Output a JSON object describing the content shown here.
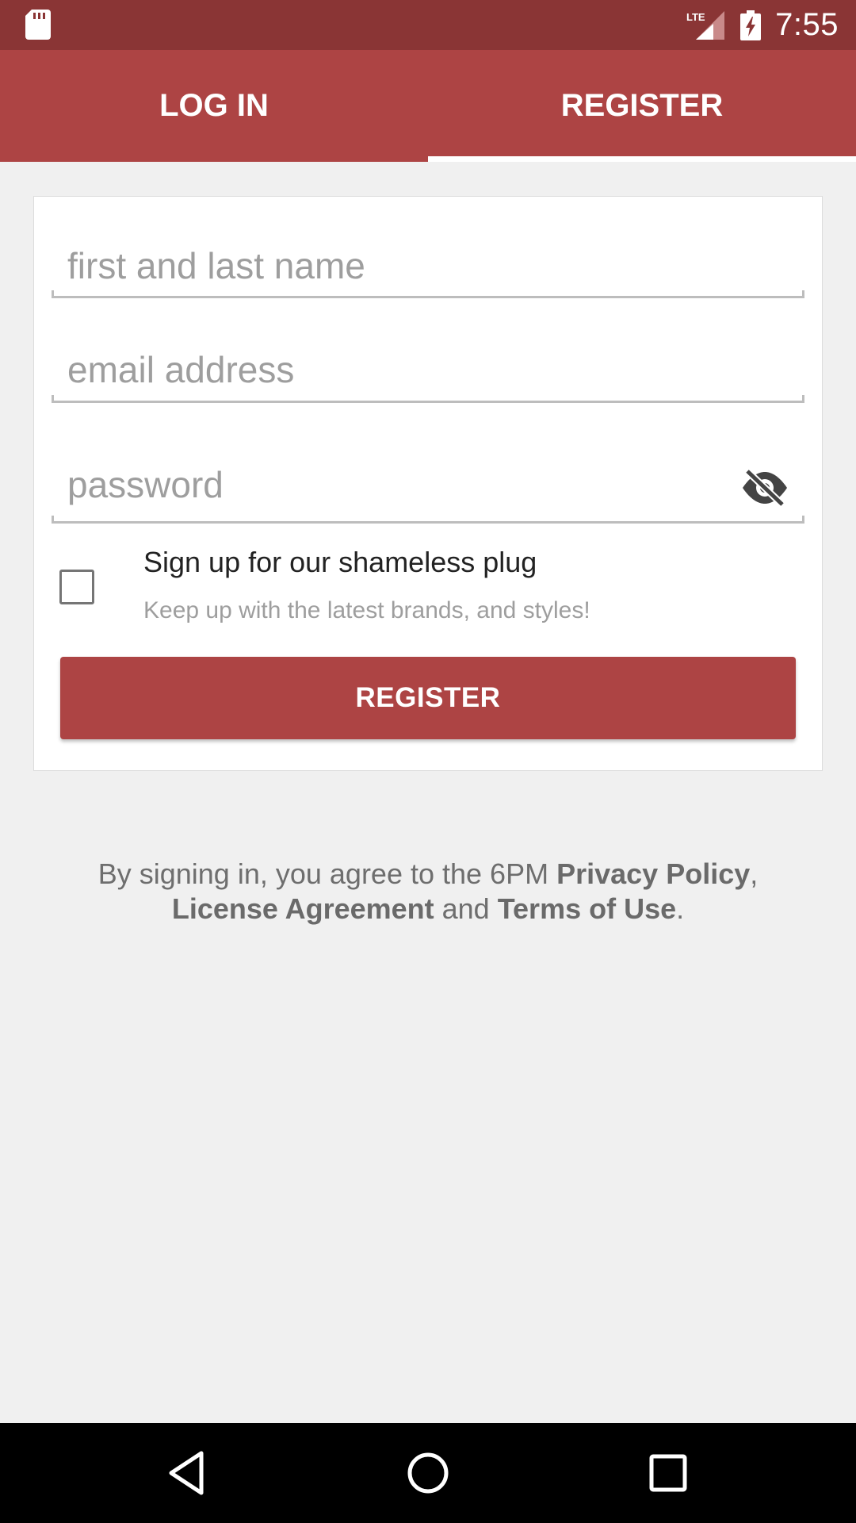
{
  "status_bar": {
    "time": "7:55",
    "network_label": "LTE",
    "icons": [
      "sd-card-icon",
      "lte-signal-icon",
      "battery-charging-icon"
    ]
  },
  "tabs": [
    {
      "label": "LOG IN",
      "active": false
    },
    {
      "label": "REGISTER",
      "active": true
    }
  ],
  "form": {
    "name_placeholder": "first and last name",
    "email_placeholder": "email address",
    "password_placeholder": "password",
    "name_value": "",
    "email_value": "",
    "password_value": "",
    "password_toggle_icon": "eye-off-icon",
    "optin": {
      "checked": false,
      "title": "Sign up for our shameless plug",
      "subtitle": "Keep up with the latest brands, and styles!"
    },
    "submit_label": "REGISTER"
  },
  "legal": {
    "prefix": "By signing in, you agree to the 6PM ",
    "privacy_link": "Privacy Policy",
    "comma": ",",
    "license_link": "License Agreement",
    "and_text": " and ",
    "terms_link": "Terms of Use",
    "period": "."
  },
  "colors": {
    "status_bar": "#8a3535",
    "brand_red": "#ad4444",
    "background": "#f0f0f0"
  },
  "nav_bar": {
    "icons": [
      "back-icon",
      "home-icon",
      "recent-apps-icon"
    ]
  }
}
